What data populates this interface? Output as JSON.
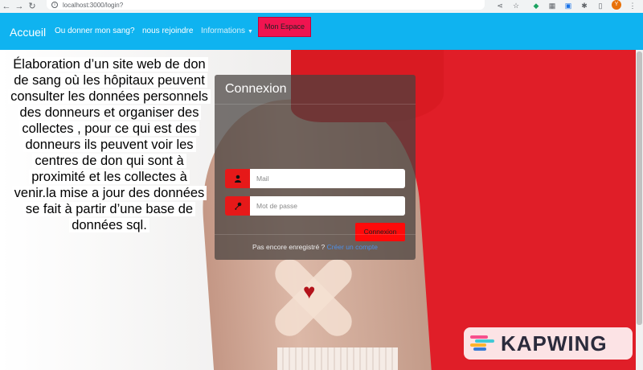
{
  "browser": {
    "url": "localhost:3000/login?",
    "avatar_letter": "Y"
  },
  "navbar": {
    "brand": "Accueil",
    "links": [
      "Ou donner mon sang?",
      "nous rejoindre",
      "Informations"
    ],
    "espace_button": "Mon Espace"
  },
  "description": "Élaboration d’un site web de don de sang où les hôpitaux peuvent consulter les données personnels des donneurs et organiser des collectes , pour ce qui est des donneurs ils peuvent voir les centres de don qui sont à proximité et les collectes à venir.la mise a jour des données se fait à partir d’une base de données sql.",
  "login": {
    "title": "Connexion",
    "mail_placeholder": "Mail",
    "password_placeholder": "Mot de passe",
    "submit_label": "Connexion",
    "footer_text": "Pas encore enregistré ?",
    "footer_link": "Créer un compte"
  },
  "watermark": {
    "text": "KAPWING"
  },
  "colors": {
    "navbar": "#0fb3f0",
    "accent_red": "#e61919",
    "espace_button": "#f01450",
    "link_blue": "#4d8fe6"
  }
}
